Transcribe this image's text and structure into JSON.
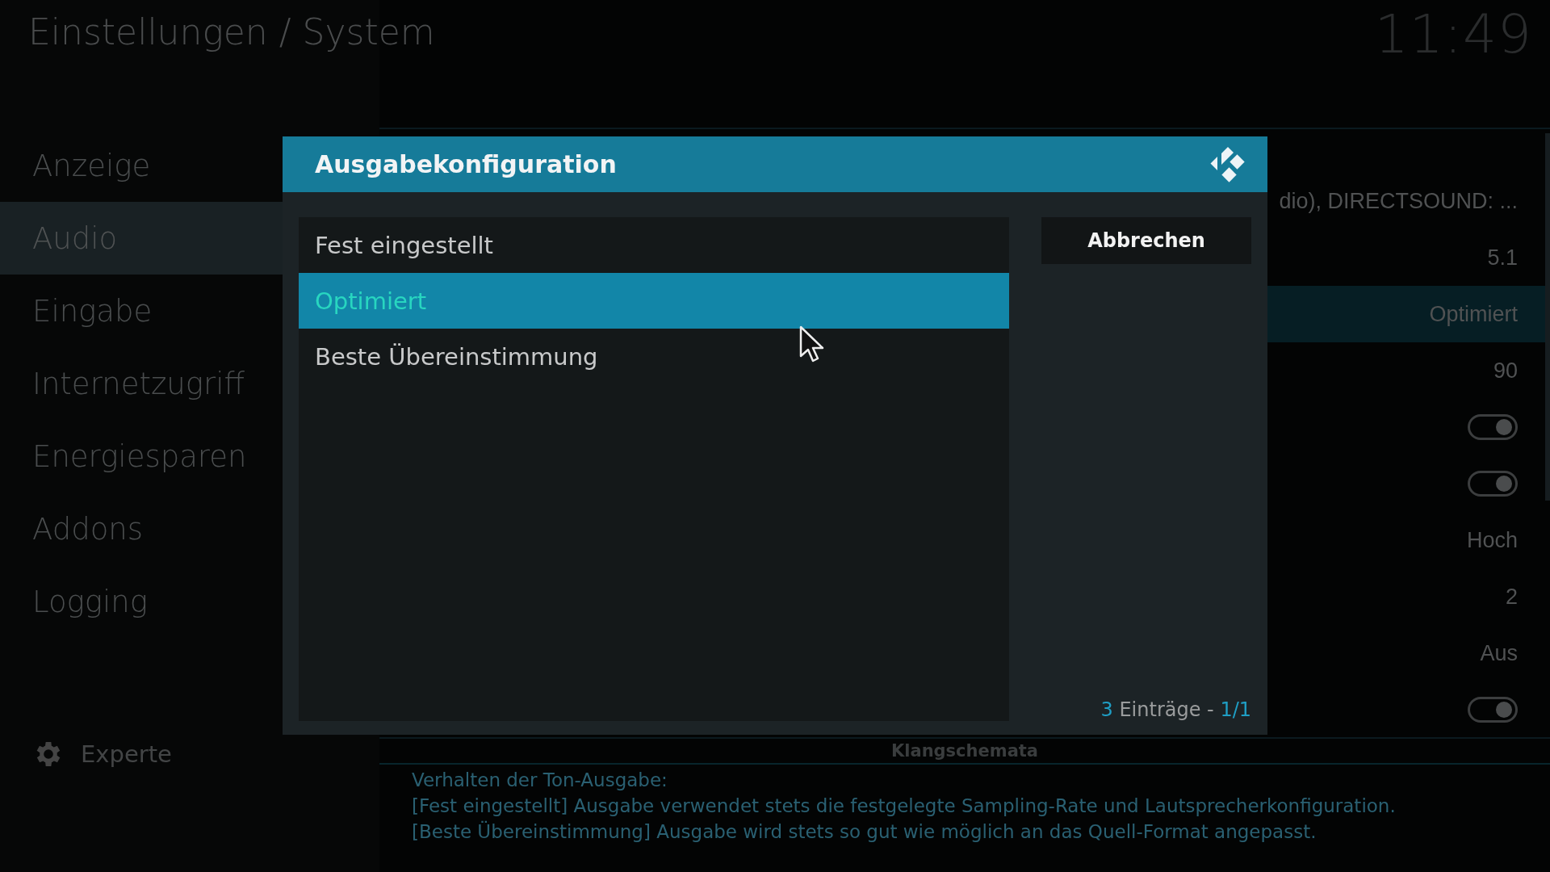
{
  "header": {
    "title": "Einstellungen / System",
    "clock": "11:49"
  },
  "sidebar": {
    "items": [
      {
        "label": "Anzeige",
        "selected": false
      },
      {
        "label": "Audio",
        "selected": true
      },
      {
        "label": "Eingabe",
        "selected": false
      },
      {
        "label": "Internetzugriff",
        "selected": false
      },
      {
        "label": "Energiesparen",
        "selected": false
      },
      {
        "label": "Addons",
        "selected": false
      },
      {
        "label": "Logging",
        "selected": false
      }
    ],
    "level_button": "Experte"
  },
  "settings": {
    "rows": [
      {
        "kind": "text",
        "value": "dio), DIRECTSOUND: ...",
        "selected": false
      },
      {
        "kind": "text",
        "value": "5.1",
        "selected": false
      },
      {
        "kind": "text",
        "value": "Optimiert",
        "selected": true
      },
      {
        "kind": "text",
        "value": "90",
        "selected": false
      },
      {
        "kind": "toggle",
        "on": true,
        "selected": false
      },
      {
        "kind": "toggle",
        "on": true,
        "selected": false
      },
      {
        "kind": "text",
        "value": "Hoch",
        "selected": false
      },
      {
        "kind": "text",
        "value": "2",
        "selected": false
      },
      {
        "kind": "text",
        "value": "Aus",
        "selected": false
      },
      {
        "kind": "toggle",
        "on": true,
        "selected": false
      }
    ],
    "group_heading": "Klangschemata",
    "description": [
      "Verhalten der Ton-Ausgabe:",
      "[Fest eingestellt] Ausgabe verwendet stets die festgelegte Sampling-Rate und Lautsprecherkonfiguration.",
      "[Beste Übereinstimmung] Ausgabe wird stets so gut wie möglich an das Quell-Format angepasst."
    ]
  },
  "dialog": {
    "title": "Ausgabekonfiguration",
    "options": [
      {
        "label": "Fest eingestellt",
        "selected": false
      },
      {
        "label": "Optimiert",
        "selected": true
      },
      {
        "label": "Beste Übereinstimmung",
        "selected": false
      }
    ],
    "cancel_button": "Abbrechen",
    "count": {
      "number": "3",
      "label": "Einträge -",
      "page": "1/1"
    }
  }
}
